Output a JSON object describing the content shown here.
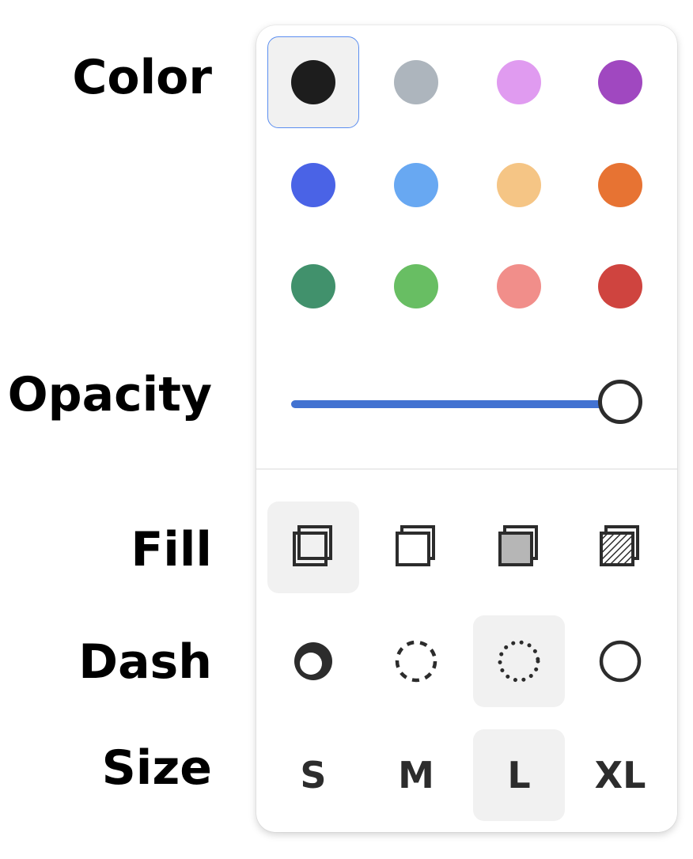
{
  "labels": {
    "color": "Color",
    "opacity": "Opacity",
    "fill": "Fill",
    "dash": "Dash",
    "size": "Size"
  },
  "colors": [
    {
      "name": "black",
      "hex": "#1d1d1d",
      "selected": true
    },
    {
      "name": "grey",
      "hex": "#adb5bd",
      "selected": false
    },
    {
      "name": "light-violet",
      "hex": "#e09bf0",
      "selected": false
    },
    {
      "name": "violet",
      "hex": "#a048c0",
      "selected": false
    },
    {
      "name": "blue",
      "hex": "#4a63e6",
      "selected": false
    },
    {
      "name": "light-blue",
      "hex": "#68a8f2",
      "selected": false
    },
    {
      "name": "yellow",
      "hex": "#f5c585",
      "selected": false
    },
    {
      "name": "orange",
      "hex": "#e77333",
      "selected": false
    },
    {
      "name": "green",
      "hex": "#41916c",
      "selected": false
    },
    {
      "name": "light-green",
      "hex": "#68be63",
      "selected": false
    },
    {
      "name": "light-red",
      "hex": "#f18e8a",
      "selected": false
    },
    {
      "name": "red",
      "hex": "#cf443f",
      "selected": false
    }
  ],
  "opacity": {
    "value": 1.0,
    "track_color": "#4272d1"
  },
  "fill": {
    "options": [
      "none-icon",
      "semi-icon",
      "solid-icon",
      "pattern-icon"
    ],
    "selected": 0
  },
  "dash": {
    "options": [
      "draw-icon",
      "dashed-icon",
      "dotted-icon",
      "solid-icon"
    ],
    "selected": 2
  },
  "size": {
    "options": [
      "S",
      "M",
      "L",
      "XL"
    ],
    "selected": 2
  },
  "accent": "#5b8ef0",
  "icon_color": "#2c2c2c"
}
